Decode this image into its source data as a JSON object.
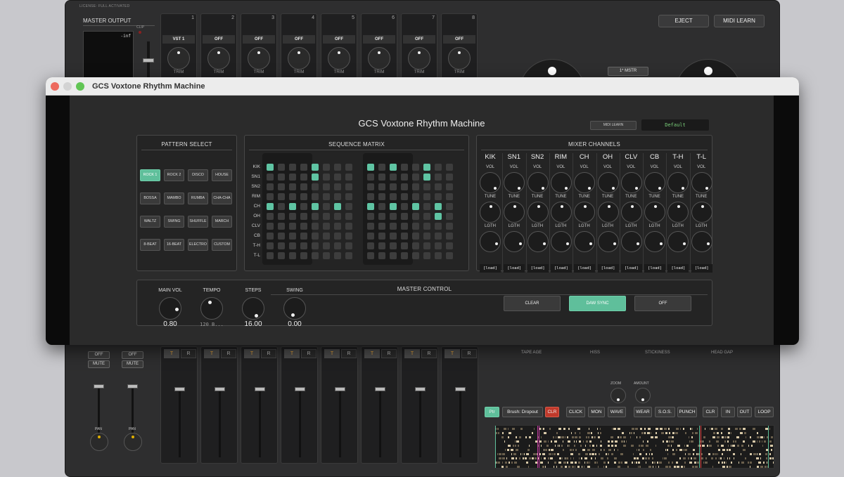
{
  "host": {
    "license": "LICENSE: FULL ACTIVATED",
    "master_output": "MASTER OUTPUT",
    "clip": "CLIP",
    "meter_value": "-inf",
    "channels": [
      {
        "num": "1",
        "label": "VST 1",
        "trim": "TRIM"
      },
      {
        "num": "2",
        "label": "OFF",
        "trim": "TRIM"
      },
      {
        "num": "3",
        "label": "OFF",
        "trim": "TRIM"
      },
      {
        "num": "4",
        "label": "OFF",
        "trim": "TRIM"
      },
      {
        "num": "5",
        "label": "OFF",
        "trim": "TRIM"
      },
      {
        "num": "6",
        "label": "OFF",
        "trim": "TRIM"
      },
      {
        "num": "7",
        "label": "OFF",
        "trim": "TRIM"
      },
      {
        "num": "8",
        "label": "OFF",
        "trim": "TRIM"
      }
    ],
    "eject": "EJECT",
    "midi_learn": "MIDI LEARN",
    "mstr": "1* MSTR",
    "side": [
      {
        "off": "OFF",
        "mute": "MUTE",
        "pan": "PAN"
      },
      {
        "off": "OFF",
        "mute": "MUTE",
        "pan": "PAN"
      }
    ],
    "strip_t": "T",
    "strip_r": "R",
    "tape_labels": [
      "TAPE AGE",
      "HISS",
      "STICKINESS",
      "HEAD GAP"
    ],
    "zoom": "ZOOM",
    "amount": "AMOUNT",
    "tools_left": [
      {
        "label": "Ptr",
        "style": "green"
      },
      {
        "label": "Brush: Dropout",
        "style": "normal"
      },
      {
        "label": "CLR",
        "style": "red"
      },
      {
        "label": "CLICK",
        "style": "normal"
      },
      {
        "label": "MON",
        "style": "normal"
      },
      {
        "label": "WAVE",
        "style": "normal"
      },
      {
        "label": "WEAR",
        "style": "normal"
      },
      {
        "label": "S.O.S.",
        "style": "normal"
      },
      {
        "label": "PUNCH",
        "style": "normal"
      },
      {
        "label": "CLR",
        "style": "normal"
      },
      {
        "label": "IN",
        "style": "normal"
      },
      {
        "label": "OUT",
        "style": "normal"
      },
      {
        "label": "LOOP",
        "style": "normal"
      }
    ]
  },
  "window": {
    "title": "GCS Voxtone Rhythm Machine"
  },
  "plugin": {
    "title": "GCS Voxtone Rhythm Machine",
    "midi_learn": "MIDI LEARN",
    "preset": "Default",
    "pattern_select": {
      "heading": "PATTERN SELECT",
      "patterns": [
        "ROCK 1",
        "ROCK 2",
        "DISCO",
        "HOUSE",
        "BOSSA",
        "MAMBO",
        "RUMBA",
        "CHA-CHA",
        "WALTZ",
        "SWING",
        "SHUFFLE",
        "MARCH",
        "8-BEAT",
        "16-BEAT",
        "ELECTRO",
        "CUSTOM"
      ],
      "active": "ROCK 1"
    },
    "sequence_matrix": {
      "heading": "SEQUENCE MATRIX",
      "rows": [
        "KIK",
        "SN1",
        "SN2",
        "RIM",
        "CH",
        "OH",
        "CLV",
        "CB",
        "T-H",
        "T-L"
      ],
      "steps": 16,
      "on": {
        "KIK": [
          0,
          4,
          8,
          10,
          13
        ],
        "SN1": [
          4,
          13
        ],
        "CH": [
          0,
          2,
          4,
          6,
          8,
          10,
          12,
          14
        ],
        "OH": [
          14
        ]
      }
    },
    "mixer": {
      "heading": "MIXER CHANNELS",
      "channels": [
        "KIK",
        "SN1",
        "SN2",
        "RIM",
        "CH",
        "OH",
        "CLV",
        "CB",
        "T-H",
        "T-L"
      ],
      "vol": "VOL",
      "tune": "TUNE",
      "lgth": "LGTH",
      "load": "[load]"
    },
    "master_control": {
      "heading": "MASTER CONTROL",
      "knobs": [
        {
          "label": "MAIN VOL",
          "value": "0.80"
        },
        {
          "label": "TEMPO",
          "value": "120 B..."
        },
        {
          "label": "STEPS",
          "value": "16.00"
        },
        {
          "label": "SWING",
          "value": "0.00"
        }
      ],
      "clear": "CLEAR",
      "daw_sync": "DAW SYNC",
      "off": "OFF"
    }
  },
  "colors": {
    "accent": "#5fc4a3",
    "close": "#ed6a5e",
    "minimize": "#d3d3d3",
    "zoom": "#61c554",
    "clr_red": "#c0392b"
  }
}
